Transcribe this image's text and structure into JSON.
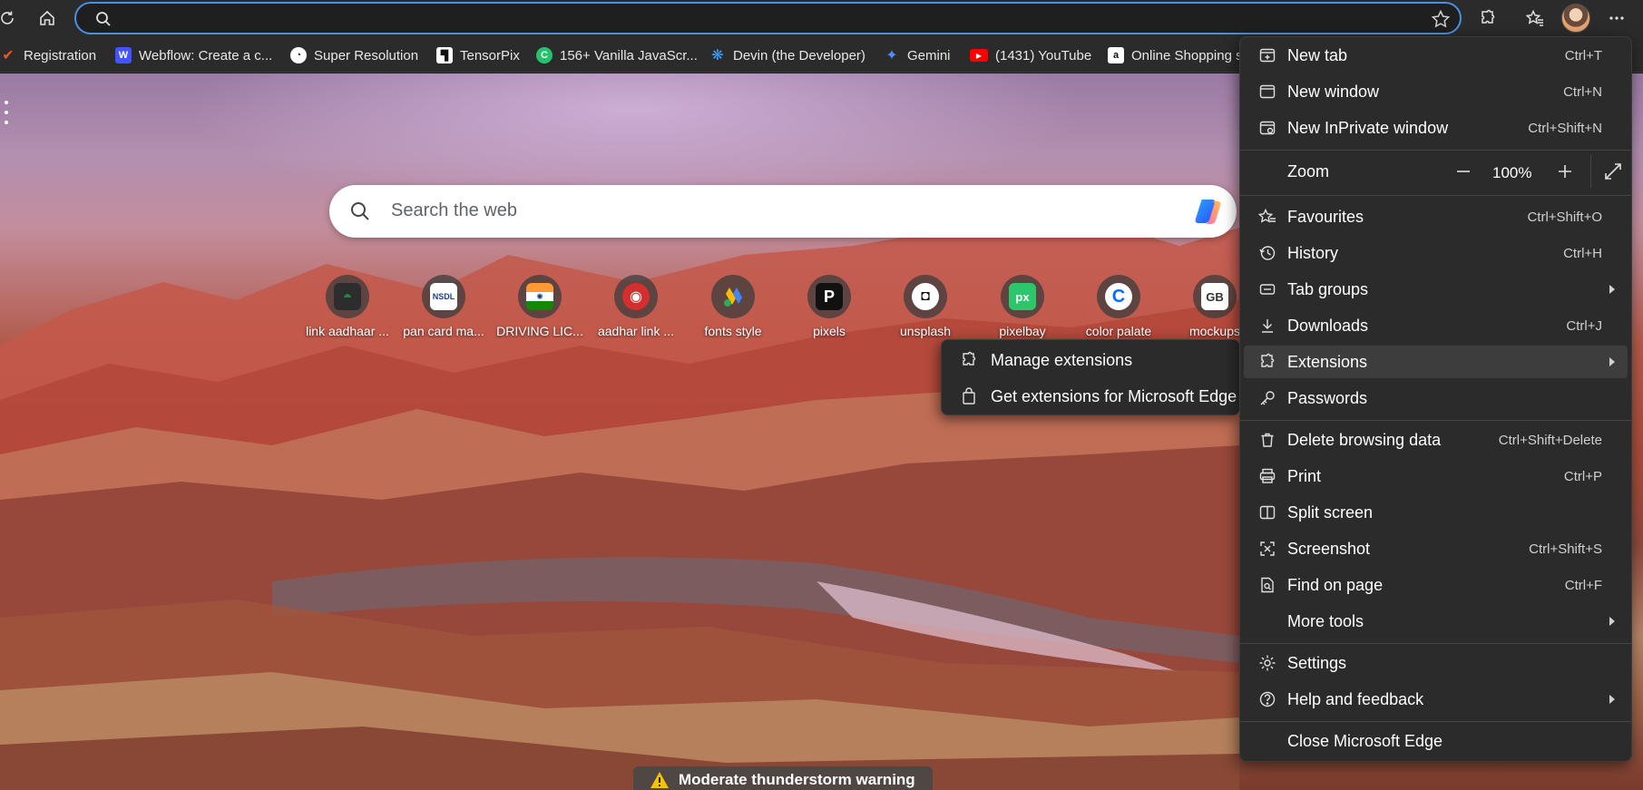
{
  "address_bar": {
    "value": "",
    "placeholder": ""
  },
  "bookmarks": [
    {
      "label": "Registration",
      "icon": "check-icon",
      "color": "#e8562a"
    },
    {
      "label": "Webflow: Create a c...",
      "icon": "webflow-icon",
      "color": "#4353ff"
    },
    {
      "label": "Super Resolution",
      "icon": "super-resolution-icon",
      "color": "#ffffff"
    },
    {
      "label": "TensorPix",
      "icon": "tensorpix-icon",
      "color": "#ffffff"
    },
    {
      "label": "156+ Vanilla JavaScr...",
      "icon": "vanilla-js-icon",
      "color": "#25c26e"
    },
    {
      "label": "Devin (the Developer)",
      "icon": "devin-icon",
      "color": "#3aa0ff"
    },
    {
      "label": "Gemini",
      "icon": "gemini-icon",
      "color": "#4f8cff"
    },
    {
      "label": "(1431) YouTube",
      "icon": "youtube-icon",
      "color": "#ff0000"
    },
    {
      "label": "Online Shopping s",
      "icon": "amazon-icon",
      "color": "#ffffff"
    }
  ],
  "search": {
    "placeholder": "Search the web"
  },
  "quick_links": [
    {
      "label": "link aadhaar ...",
      "icon": "aadhaar-icon",
      "color": "#1b8a3c"
    },
    {
      "label": "pan card ma...",
      "icon": "nsdl-icon",
      "color": "#ffffff",
      "text": "NSDL"
    },
    {
      "label": "DRIVING LIC...",
      "icon": "india-flag-icon",
      "color": "#ff9933"
    },
    {
      "label": "aadhar link ...",
      "icon": "aadhar-fingerprint-icon",
      "color": "#d32f2f"
    },
    {
      "label": "fonts style",
      "icon": "google-ads-icon",
      "color": "#fbbc04"
    },
    {
      "label": "pixels",
      "icon": "pexels-icon",
      "color": "#111111",
      "text": "P"
    },
    {
      "label": "unsplash",
      "icon": "unsplash-icon",
      "color": "#111111"
    },
    {
      "label": "pixelbay",
      "icon": "pixabay-icon",
      "color": "#2ec66d",
      "text": "px"
    },
    {
      "label": "color palate",
      "icon": "coolors-icon",
      "color": "#0a6cff",
      "text": "C"
    },
    {
      "label": "mockups",
      "icon": "gb-icon",
      "color": "#555555",
      "text": "GB"
    }
  ],
  "weather": {
    "label": "Moderate thunderstorm warning"
  },
  "menu": {
    "new_tab": {
      "label": "New tab",
      "shortcut": "Ctrl+T"
    },
    "new_window": {
      "label": "New window",
      "shortcut": "Ctrl+N"
    },
    "new_inprivate": {
      "label": "New InPrivate window",
      "shortcut": "Ctrl+Shift+N"
    },
    "zoom": {
      "label": "Zoom",
      "minus": "—",
      "value": "100%",
      "plus": "+"
    },
    "favourites": {
      "label": "Favourites",
      "shortcut": "Ctrl+Shift+O"
    },
    "history": {
      "label": "History",
      "shortcut": "Ctrl+H"
    },
    "tab_groups": {
      "label": "Tab groups"
    },
    "downloads": {
      "label": "Downloads",
      "shortcut": "Ctrl+J"
    },
    "extensions": {
      "label": "Extensions"
    },
    "passwords": {
      "label": "Passwords"
    },
    "delete_browsing": {
      "label": "Delete browsing data",
      "shortcut": "Ctrl+Shift+Delete"
    },
    "print": {
      "label": "Print",
      "shortcut": "Ctrl+P"
    },
    "split_screen": {
      "label": "Split screen"
    },
    "screenshot": {
      "label": "Screenshot",
      "shortcut": "Ctrl+Shift+S"
    },
    "find_on_page": {
      "label": "Find on page",
      "shortcut": "Ctrl+F"
    },
    "more_tools": {
      "label": "More tools"
    },
    "settings": {
      "label": "Settings"
    },
    "help": {
      "label": "Help and feedback"
    },
    "close_edge": {
      "label": "Close Microsoft Edge"
    }
  },
  "extensions_submenu": {
    "manage": {
      "label": "Manage extensions"
    },
    "get": {
      "label": "Get extensions for Microsoft Edge"
    }
  },
  "colors": {
    "accent": "#4a90e2",
    "menu_bg": "#2b2b2b",
    "active_item": "#3d3d3d"
  }
}
